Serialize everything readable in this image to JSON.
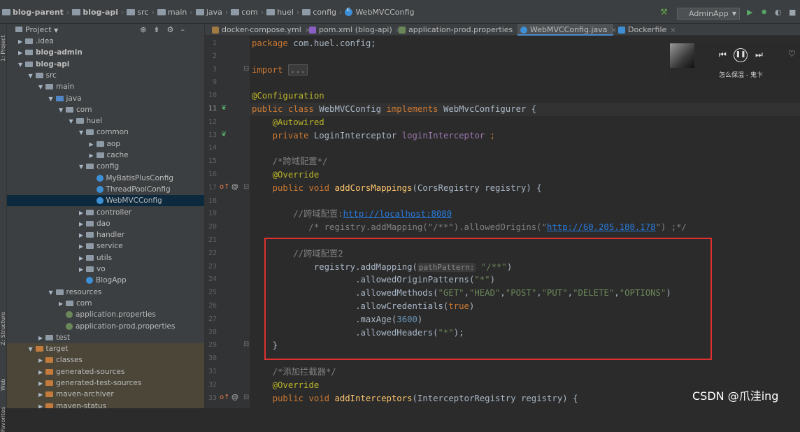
{
  "breadcrumb": [
    {
      "label": "blog-parent",
      "bold": true
    },
    {
      "label": "blog-api",
      "bold": true
    },
    {
      "label": "src"
    },
    {
      "label": "main"
    },
    {
      "label": "java"
    },
    {
      "label": "com"
    },
    {
      "label": "huel"
    },
    {
      "label": "config"
    },
    {
      "label": "WebMVCConfig"
    }
  ],
  "run_config": "AdminApp",
  "project_panel": {
    "title": "Project",
    "side_labels": [
      "1: Project",
      "Z: Structure",
      "Web",
      "Favorites"
    ],
    "tree": [
      {
        "label": ".idea",
        "level": 1,
        "arrow": "▶",
        "icon": "folder"
      },
      {
        "label": "blog-admin",
        "level": 1,
        "arrow": "▶",
        "icon": "folder",
        "bold": true
      },
      {
        "label": "blog-api",
        "level": 1,
        "arrow": "▼",
        "icon": "folder",
        "bold": true
      },
      {
        "label": "src",
        "level": 2,
        "arrow": "▼",
        "icon": "folder"
      },
      {
        "label": "main",
        "level": 3,
        "arrow": "▼",
        "icon": "folder"
      },
      {
        "label": "java",
        "level": 4,
        "arrow": "▼",
        "icon": "src"
      },
      {
        "label": "com",
        "level": 5,
        "arrow": "▼",
        "icon": "pkg"
      },
      {
        "label": "huel",
        "level": 6,
        "arrow": "▼",
        "icon": "pkg"
      },
      {
        "label": "common",
        "level": 7,
        "arrow": "▼",
        "icon": "pkg"
      },
      {
        "label": "aop",
        "level": 8,
        "arrow": "▶",
        "icon": "pkg"
      },
      {
        "label": "cache",
        "level": 8,
        "arrow": "▶",
        "icon": "pkg"
      },
      {
        "label": "config",
        "level": 7,
        "arrow": "▼",
        "icon": "pkg"
      },
      {
        "label": "MyBatisPlusConfig",
        "level": 8,
        "arrow": "",
        "icon": "class"
      },
      {
        "label": "ThreadPoolConfig",
        "level": 8,
        "arrow": "",
        "icon": "class"
      },
      {
        "label": "WebMVCConfig",
        "level": 8,
        "arrow": "",
        "icon": "class",
        "selected": true
      },
      {
        "label": "controller",
        "level": 7,
        "arrow": "▶",
        "icon": "pkg"
      },
      {
        "label": "dao",
        "level": 7,
        "arrow": "▶",
        "icon": "pkg"
      },
      {
        "label": "handler",
        "level": 7,
        "arrow": "▶",
        "icon": "pkg"
      },
      {
        "label": "service",
        "level": 7,
        "arrow": "▶",
        "icon": "pkg"
      },
      {
        "label": "utils",
        "level": 7,
        "arrow": "▶",
        "icon": "pkg"
      },
      {
        "label": "vo",
        "level": 7,
        "arrow": "▶",
        "icon": "pkg"
      },
      {
        "label": "BlogApp",
        "level": 7,
        "arrow": "",
        "icon": "class"
      },
      {
        "label": "resources",
        "level": 4,
        "arrow": "▼",
        "icon": "res"
      },
      {
        "label": "com",
        "level": 5,
        "arrow": "▶",
        "icon": "pkg"
      },
      {
        "label": "application.properties",
        "level": 5,
        "arrow": "",
        "icon": "prop"
      },
      {
        "label": "application-prod.properties",
        "level": 5,
        "arrow": "",
        "icon": "prop"
      },
      {
        "label": "test",
        "level": 3,
        "arrow": "▶",
        "icon": "folder"
      },
      {
        "label": "target",
        "level": 2,
        "arrow": "▼",
        "icon": "org",
        "target": true
      },
      {
        "label": "classes",
        "level": 3,
        "arrow": "▶",
        "icon": "org",
        "target": true
      },
      {
        "label": "generated-sources",
        "level": 3,
        "arrow": "▶",
        "icon": "org",
        "target": true
      },
      {
        "label": "generated-test-sources",
        "level": 3,
        "arrow": "▶",
        "icon": "org",
        "target": true
      },
      {
        "label": "maven-archiver",
        "level": 3,
        "arrow": "▶",
        "icon": "org",
        "target": true
      },
      {
        "label": "maven-status",
        "level": 3,
        "arrow": "▶",
        "icon": "org",
        "target": true
      }
    ]
  },
  "tabs": [
    {
      "label": "docker-compose.yml",
      "icon": "yml"
    },
    {
      "label": "pom.xml (blog-api)",
      "icon": "m"
    },
    {
      "label": "application-prod.properties",
      "icon": "prop"
    },
    {
      "label": "WebMVCConfig.java",
      "icon": "class",
      "active": true
    },
    {
      "label": "Dockerfile",
      "icon": "docker"
    }
  ],
  "editor": {
    "current_line": 11,
    "lines": [
      {
        "n": 1,
        "tokens": [
          [
            "k",
            "package "
          ],
          [
            "t",
            "com.huel.config;"
          ]
        ]
      },
      {
        "n": 2,
        "tokens": []
      },
      {
        "n": 3,
        "tokens": [
          [
            "k",
            "import "
          ],
          [
            "fold",
            "..."
          ]
        ]
      },
      {
        "n": 9,
        "tokens": []
      },
      {
        "n": 10,
        "tokens": [
          [
            "a",
            "@Configuration"
          ]
        ]
      },
      {
        "n": 11,
        "tokens": [
          [
            "k",
            "public class "
          ],
          [
            "t",
            "WebMVCConfig "
          ],
          [
            "k",
            "implements "
          ],
          [
            "t",
            "WebMvcConfigurer {"
          ]
        ]
      },
      {
        "n": 12,
        "tokens": [
          [
            "t",
            "    "
          ],
          [
            "a",
            "@Autowired"
          ]
        ]
      },
      {
        "n": 13,
        "tokens": [
          [
            "t",
            "    "
          ],
          [
            "k",
            "private "
          ],
          [
            "t",
            "LoginInterceptor "
          ],
          [
            "f",
            "loginInterceptor "
          ],
          [
            "k",
            ";"
          ]
        ]
      },
      {
        "n": 14,
        "tokens": []
      },
      {
        "n": 15,
        "tokens": [
          [
            "cm",
            "    /*跨域配置*/"
          ]
        ]
      },
      {
        "n": 16,
        "tokens": [
          [
            "t",
            "    "
          ],
          [
            "a",
            "@Override"
          ]
        ]
      },
      {
        "n": 17,
        "tokens": [
          [
            "t",
            "    "
          ],
          [
            "k",
            "public void "
          ],
          [
            "m",
            "addCorsMappings"
          ],
          [
            "t",
            "(CorsRegistry registry) {"
          ]
        ]
      },
      {
        "n": 18,
        "tokens": []
      },
      {
        "n": 19,
        "tokens": [
          [
            "cm",
            "        //跨域配置:"
          ],
          [
            "u",
            "http://localhost:8080"
          ]
        ]
      },
      {
        "n": 20,
        "tokens": [
          [
            "cm",
            "           /* registry.addMapping(\"/**\").allowedOrigins(\""
          ],
          [
            "u",
            "http://60.205.180.178"
          ],
          [
            "cm",
            "\") ;*/"
          ]
        ]
      },
      {
        "n": 21,
        "tokens": []
      },
      {
        "n": 22,
        "tokens": [
          [
            "cm",
            "        //跨域配置2"
          ]
        ]
      },
      {
        "n": 23,
        "tokens": [
          [
            "t",
            "            registry.addMapping("
          ],
          [
            "ph",
            "pathPattern:"
          ],
          [
            "s",
            " \"/**\""
          ],
          [
            "t",
            ")"
          ]
        ]
      },
      {
        "n": 24,
        "tokens": [
          [
            "t",
            "                    .allowedOriginPatterns("
          ],
          [
            "s",
            "\"*\""
          ],
          [
            "t",
            ")"
          ]
        ]
      },
      {
        "n": 25,
        "tokens": [
          [
            "t",
            "                    .allowedMethods("
          ],
          [
            "s",
            "\"GET\""
          ],
          [
            "t",
            ","
          ],
          [
            "s",
            "\"HEAD\""
          ],
          [
            "t",
            ","
          ],
          [
            "s",
            "\"POST\""
          ],
          [
            "t",
            ","
          ],
          [
            "s",
            "\"PUT\""
          ],
          [
            "t",
            ","
          ],
          [
            "s",
            "\"DELETE\""
          ],
          [
            "t",
            ","
          ],
          [
            "s",
            "\"OPTIONS\""
          ],
          [
            "t",
            ")"
          ]
        ]
      },
      {
        "n": 26,
        "tokens": [
          [
            "t",
            "                    .allowCredentials("
          ],
          [
            "k",
            "true"
          ],
          [
            "t",
            ")"
          ]
        ]
      },
      {
        "n": 27,
        "tokens": [
          [
            "t",
            "                    .maxAge("
          ],
          [
            "n",
            "3600"
          ],
          [
            "t",
            ")"
          ]
        ]
      },
      {
        "n": 28,
        "tokens": [
          [
            "t",
            "                    .allowedHeaders("
          ],
          [
            "s",
            "\"*\""
          ],
          [
            "t",
            ");"
          ]
        ]
      },
      {
        "n": 29,
        "tokens": [
          [
            "t",
            "    }"
          ]
        ]
      },
      {
        "n": 30,
        "tokens": []
      },
      {
        "n": 31,
        "tokens": [
          [
            "cm",
            "    /*添加拦截器*/"
          ]
        ]
      },
      {
        "n": 32,
        "tokens": [
          [
            "t",
            "    "
          ],
          [
            "a",
            "@Override"
          ]
        ]
      },
      {
        "n": 33,
        "tokens": [
          [
            "t",
            "    "
          ],
          [
            "k",
            "public void "
          ],
          [
            "m",
            "addInterceptors"
          ],
          [
            "t",
            "(InterceptorRegistry registry) {"
          ]
        ]
      }
    ]
  },
  "music_player": {
    "song": "怎么保温 - 鬼卞"
  },
  "watermark": "CSDN @爪洼ing",
  "colors": {
    "keyword": "#cc7832",
    "annotation": "#bbb529",
    "string": "#6a8759",
    "comment": "#808080",
    "highlight_box": "#e03030"
  }
}
